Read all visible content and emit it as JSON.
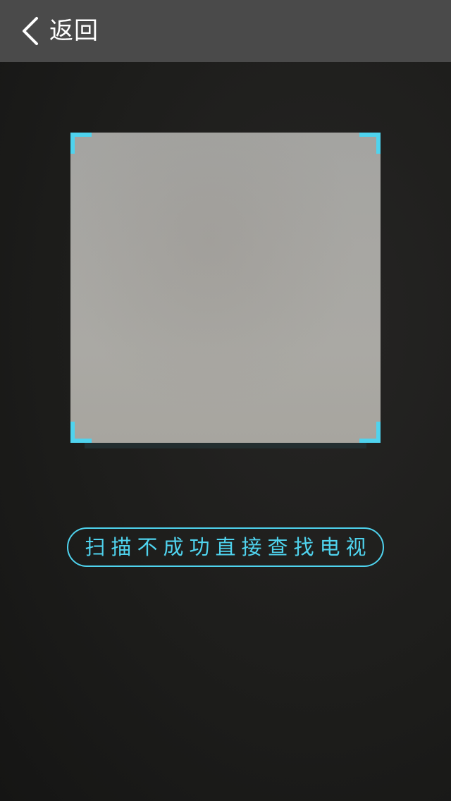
{
  "header": {
    "back_label": "返回",
    "back_icon": "chevron-left-icon"
  },
  "scanner": {
    "corner_color": "#4fd3ee"
  },
  "manual_search": {
    "label": "扫描不成功直接查找电视"
  },
  "colors": {
    "header_bg": "#4a4a4a",
    "accent": "#4fd3ee",
    "background": "#1d1d1b"
  }
}
